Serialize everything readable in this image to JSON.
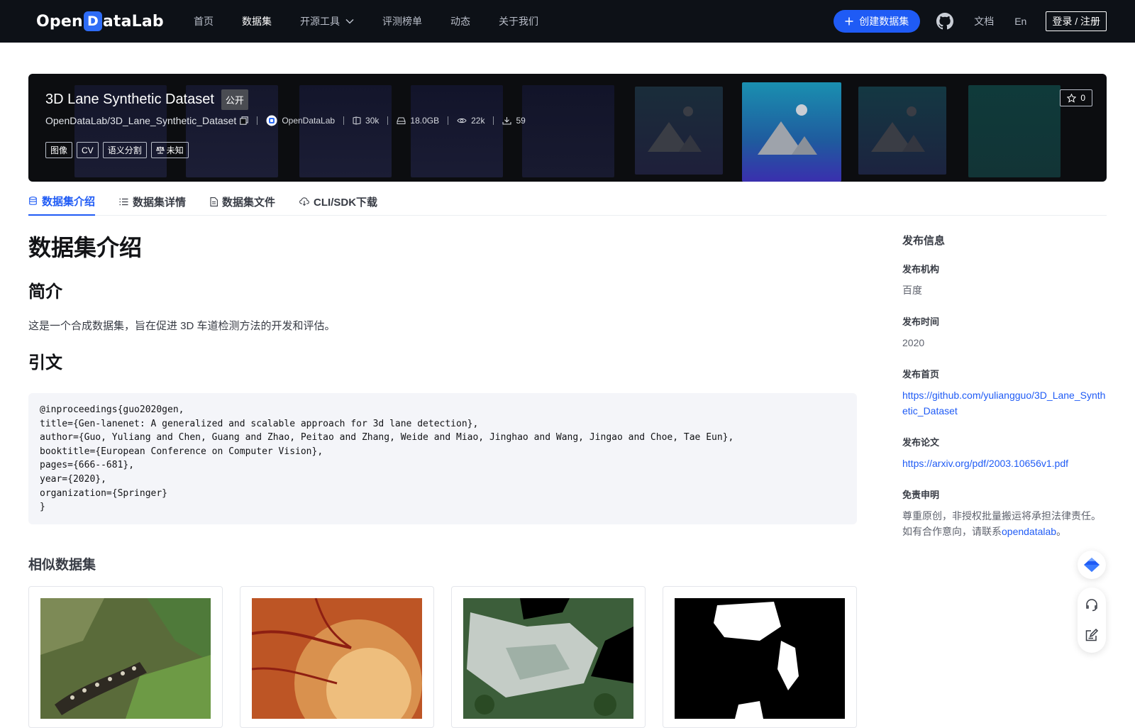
{
  "nav": {
    "logo_part1": "Open",
    "logo_box": "D",
    "logo_part2": "ataLab",
    "links": [
      "首页",
      "数据集",
      "开源工具",
      "评测榜单",
      "动态",
      "关于我们"
    ],
    "active_link": "数据集",
    "create_button": "创建数据集",
    "github_icon": "github-icon",
    "docs": "文档",
    "language": "En",
    "login": "登录 / 注册"
  },
  "hero": {
    "title": "3D Lane Synthetic Dataset",
    "visibility": "公开",
    "path": "OpenDataLab/3D_Lane_Synthetic_Dataset",
    "org": "OpenDataLab",
    "files": "30k",
    "size": "18.0GB",
    "views": "22k",
    "downloads": "59",
    "tags": [
      "图像",
      "CV",
      "语义分割"
    ],
    "license": "未知",
    "stars": "0"
  },
  "tabs": [
    "数据集介绍",
    "数据集详情",
    "数据集文件",
    "CLI/SDK下载"
  ],
  "active_tab": "数据集介绍",
  "content": {
    "heading": "数据集介绍",
    "intro_heading": "简介",
    "intro_text": "这是一个合成数据集，旨在促进 3D 车道检测方法的开发和评估。",
    "citation_heading": "引文",
    "citation": "@inproceedings{guo2020gen,\ntitle={Gen-lanenet: A generalized and scalable approach for 3d lane detection},\nauthor={Guo, Yuliang and Chen, Guang and Zhao, Peitao and Zhang, Weide and Miao, Jinghao and Wang, Jingao and Choe, Tae Eun},\nbooktitle={European Conference on Computer Vision},\npages={666--681},\nyear={2020},\norganization={Springer}\n}",
    "similar_heading": "相似数据集"
  },
  "sidebar": {
    "title": "发布信息",
    "org_label": "发布机构",
    "org_value": "百度",
    "time_label": "发布时间",
    "time_value": "2020",
    "homepage_label": "发布首页",
    "homepage_value": "https://github.com/yuliangguo/3D_Lane_Synthetic_Dataset",
    "paper_label": "发布论文",
    "paper_value": "https://arxiv.org/pdf/2003.10656v1.pdf",
    "disclaimer_label": "免责申明",
    "disclaimer_line1": "尊重原创，非授权批量搬运将承担法律责任。",
    "disclaimer_line2_prefix": "如有合作意向，请联系",
    "disclaimer_link": "opendatalab",
    "disclaimer_line2_suffix": "。"
  },
  "colors": {
    "accent": "#1f5bf5",
    "nav_bg": "#0d1117",
    "hero_bg": "#0c0d10"
  }
}
